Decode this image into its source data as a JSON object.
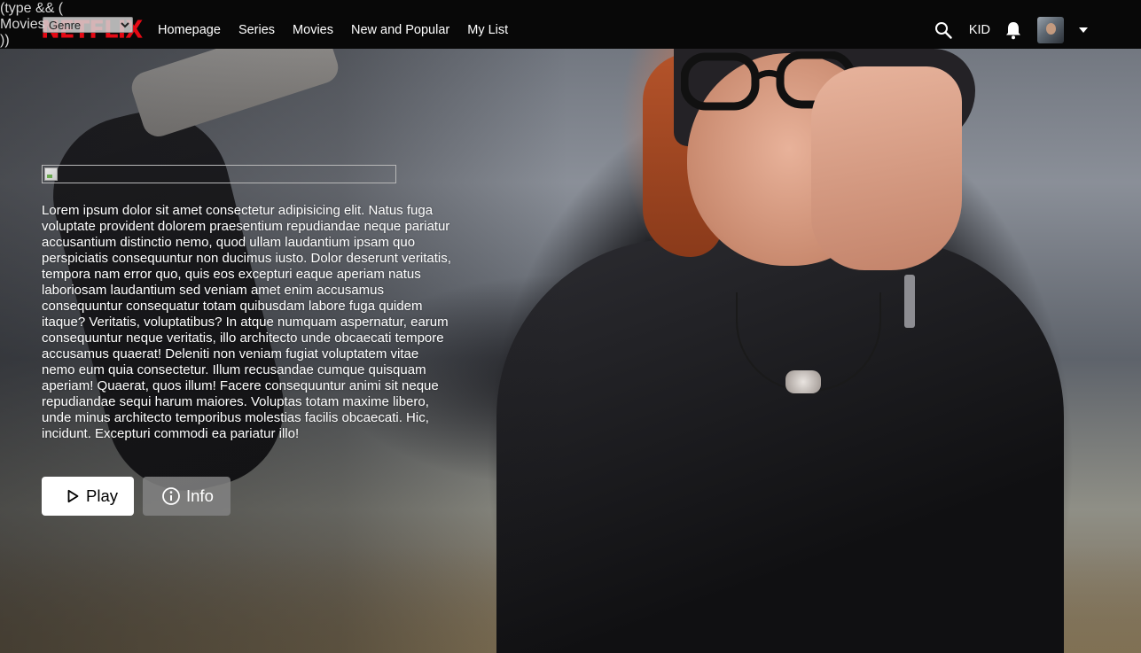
{
  "debug_text": "(type && (\nMovies\n))",
  "brand": {
    "logo_text": "NETFLIX",
    "logo_color": "#e50914"
  },
  "genre_select": {
    "selected": "Genre"
  },
  "nav": {
    "links": [
      "Homepage",
      "Series",
      "Movies",
      "New and Popular",
      "My List"
    ],
    "kid_label": "KID",
    "icons": [
      "search-icon",
      "bell-icon",
      "avatar",
      "caret-down-icon"
    ]
  },
  "hero": {
    "description": "Lorem ipsum dolor sit amet consectetur adipisicing elit. Natus fuga voluptate provident dolorem praesentium repudiandae neque pariatur accusantium distinctio nemo, quod ullam laudantium ipsam quo perspiciatis consequuntur non ducimus iusto. Dolor deserunt veritatis, tempora nam error quo, quis eos excepturi eaque aperiam natus laboriosam laudantium sed veniam amet enim accusamus consequuntur consequatur totam quibusdam labore fuga quidem itaque? Veritatis, voluptatibus? In atque numquam aspernatur, earum consequuntur neque veritatis, illo architecto unde obcaecati tempore accusamus quaerat! Deleniti non veniam fugiat voluptatem vitae nemo eum quia consectetur. Illum recusandae cumque quisquam aperiam! Quaerat, quos illum! Facere consequuntur animi sit neque repudiandae sequi harum maiores. Voluptas totam maxime libero, unde minus architecto temporibus molestias facilis obcaecati. Hic, incidunt. Excepturi commodi ea pariatur illo!",
    "play_label": "Play",
    "info_label": "Info"
  }
}
